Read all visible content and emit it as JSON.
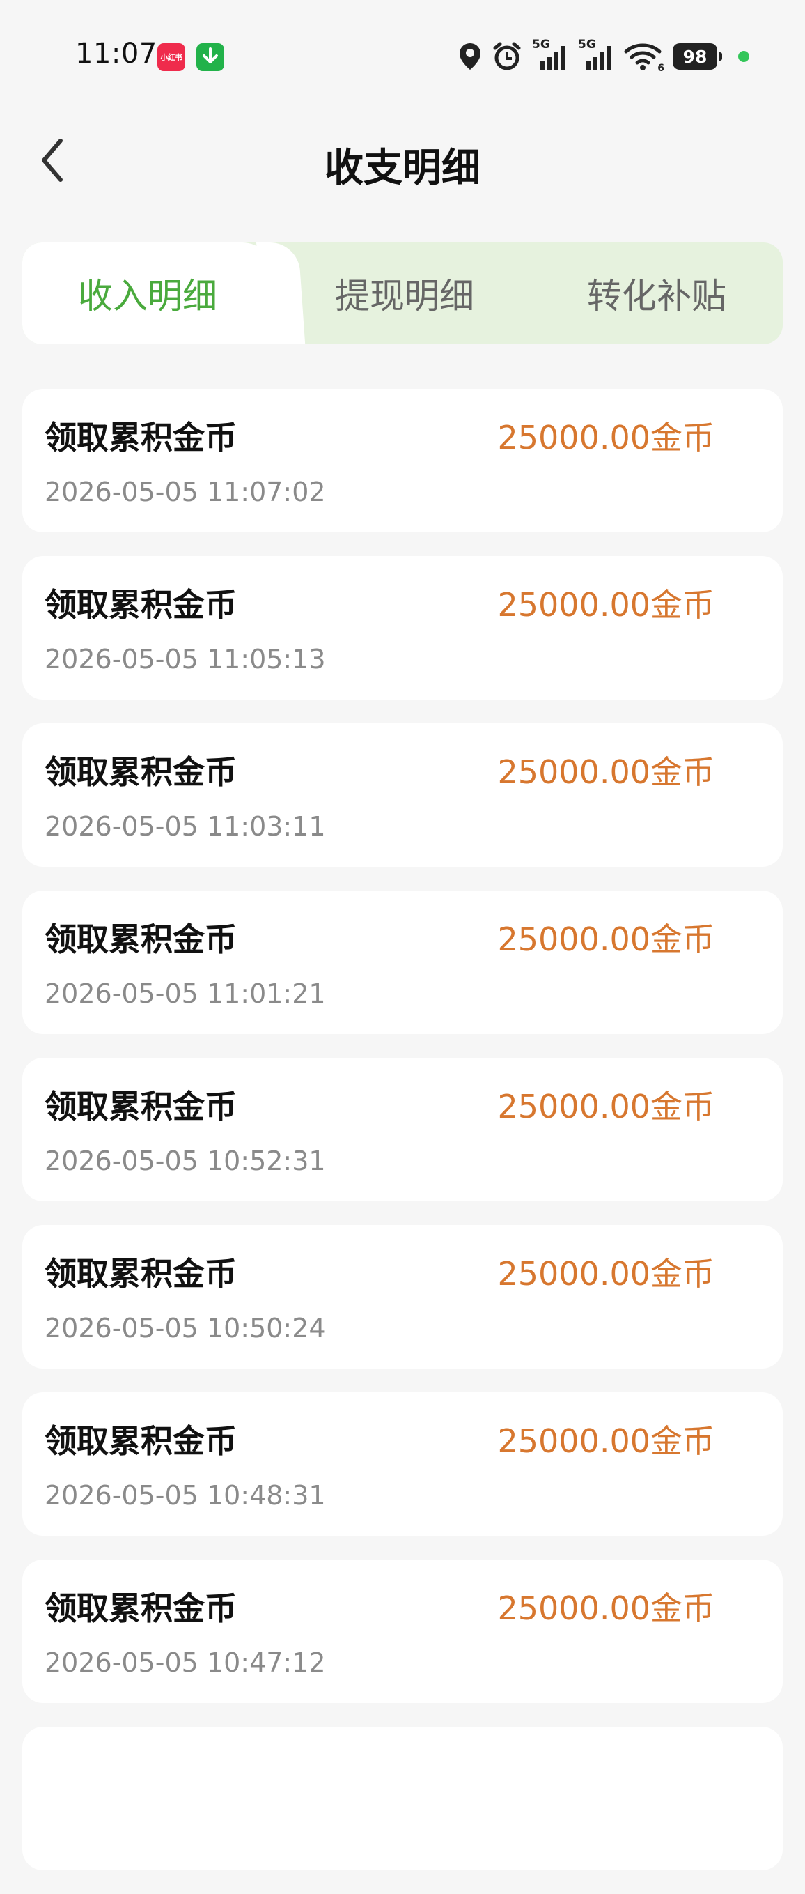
{
  "status_bar": {
    "time": "11:07",
    "notif_app_label": "小红书",
    "download_icon": "download-arrow-icon",
    "network_1": "5G",
    "network_2": "5G",
    "wifi_level": "6",
    "battery": "98"
  },
  "header": {
    "title": "收支明细",
    "back_icon": "chevron-left-icon"
  },
  "tabs": [
    {
      "label": "收入明细",
      "active": true
    },
    {
      "label": "提现明细",
      "active": false
    },
    {
      "label": "转化补贴",
      "active": false
    }
  ],
  "records": [
    {
      "title": "领取累积金币",
      "amount": "25000.00金币",
      "time": "2026-05-05 11:07:02"
    },
    {
      "title": "领取累积金币",
      "amount": "25000.00金币",
      "time": "2026-05-05 11:05:13"
    },
    {
      "title": "领取累积金币",
      "amount": "25000.00金币",
      "time": "2026-05-05 11:03:11"
    },
    {
      "title": "领取累积金币",
      "amount": "25000.00金币",
      "time": "2026-05-05 11:01:21"
    },
    {
      "title": "领取累积金币",
      "amount": "25000.00金币",
      "time": "2026-05-05 10:52:31"
    },
    {
      "title": "领取累积金币",
      "amount": "25000.00金币",
      "time": "2026-05-05 10:50:24"
    },
    {
      "title": "领取累积金币",
      "amount": "25000.00金币",
      "time": "2026-05-05 10:48:31"
    },
    {
      "title": "领取累积金币",
      "amount": "25000.00金币",
      "time": "2026-05-05 10:47:12"
    },
    {
      "title": "",
      "amount": "",
      "time": ""
    }
  ],
  "colors": {
    "accent_green": "#4aaa3d",
    "tab_bg": "#e6f2de",
    "amount_orange": "#d7772f",
    "page_bg": "#f6f6f6"
  }
}
